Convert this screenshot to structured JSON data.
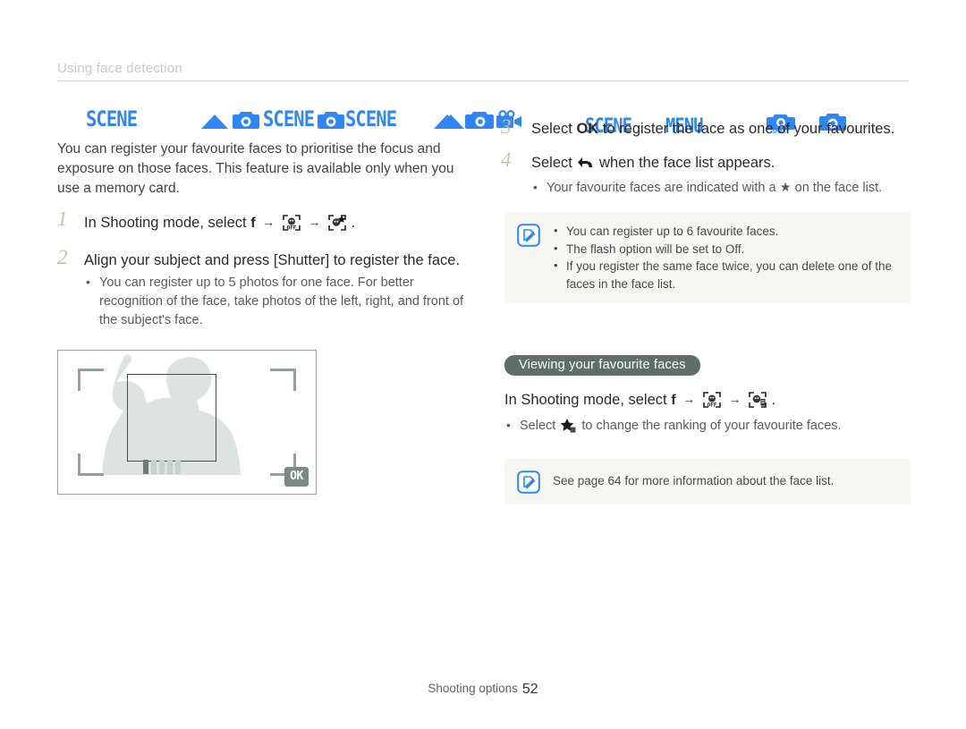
{
  "header": {
    "title": "Using face detection"
  },
  "left": {
    "mode_icons": [
      {
        "name": "scene-mode-icon",
        "label": "SCENE"
      },
      {
        "name": "program-mode-icon",
        "label": "▲"
      },
      {
        "name": "camera-mode-icon",
        "label": "camera"
      },
      {
        "name": "scene-mode-icon-2",
        "label": "SCENE"
      },
      {
        "name": "camera-mode-icon-2",
        "label": "camera"
      },
      {
        "name": "scene-mode-icon-3",
        "label": "SCENE"
      },
      {
        "name": "program-mode-icon-2",
        "label": "▲"
      },
      {
        "name": "camera-mode-icon-3",
        "label": "camera"
      }
    ],
    "intro": "You can register your favourite faces to prioritise the focus and exposure on those faces. This feature is available only when you use a memory card.",
    "steps": [
      {
        "number": "1",
        "text_before": "In Shooting mode, select",
        "f_label": "f",
        "text_after": ".",
        "bullets": []
      },
      {
        "number": "2",
        "text_before": "Align your subject and press [Shutter] to register the face.",
        "bullets": [
          "You can register up to 5 photos for one face. For better recognition of the face, take photos of the left, right, and front of the subject's face."
        ]
      }
    ],
    "lcd": {
      "ok_label": "OK",
      "bars": [
        1,
        0,
        0,
        0,
        0
      ]
    }
  },
  "right": {
    "mode_icons": [
      {
        "name": "program-mode-icon",
        "label": "▲"
      },
      {
        "name": "camera-mode-icon",
        "label": "camera"
      },
      {
        "name": "movie-mode-icon",
        "label": "video"
      }
    ],
    "steps": [
      {
        "number": "3",
        "text_before": "Select",
        "ok_label": "OK",
        "text_after": "to register the face as one of your favourites.",
        "bullets": []
      },
      {
        "number": "4",
        "text_before": "Select",
        "text_after": "when the face list appears.",
        "bullets": [
          "Your favourite faces are indicated with a ★ on the face list."
        ]
      }
    ],
    "note1": {
      "icon": "note-pen-icon",
      "items": [
        "You can register up to 6 favourite faces.",
        "The flash option will be set to Off.",
        "If you register the same face twice, you can delete one of the faces in the face list."
      ]
    },
    "section": {
      "pill_label": "Viewing your favourite faces",
      "line_before": "In Shooting mode, select",
      "f_label": "f",
      "line_after": ".",
      "bullet_before": "Select",
      "bullet_after": "to change the ranking of your favourite faces."
    },
    "note2": {
      "icon": "note-pen-icon",
      "text": "See page 64 for more information about the face list."
    }
  },
  "footer": {
    "section_label": "Shooting options",
    "page_number": "52"
  },
  "colors": {
    "mode_blue": "#2f86f6",
    "step_number": "#c3c7a4",
    "pill_bg": "#5f6e68",
    "note_bg": "#f7f6f2",
    "header_gray": "#c3cdc8"
  }
}
